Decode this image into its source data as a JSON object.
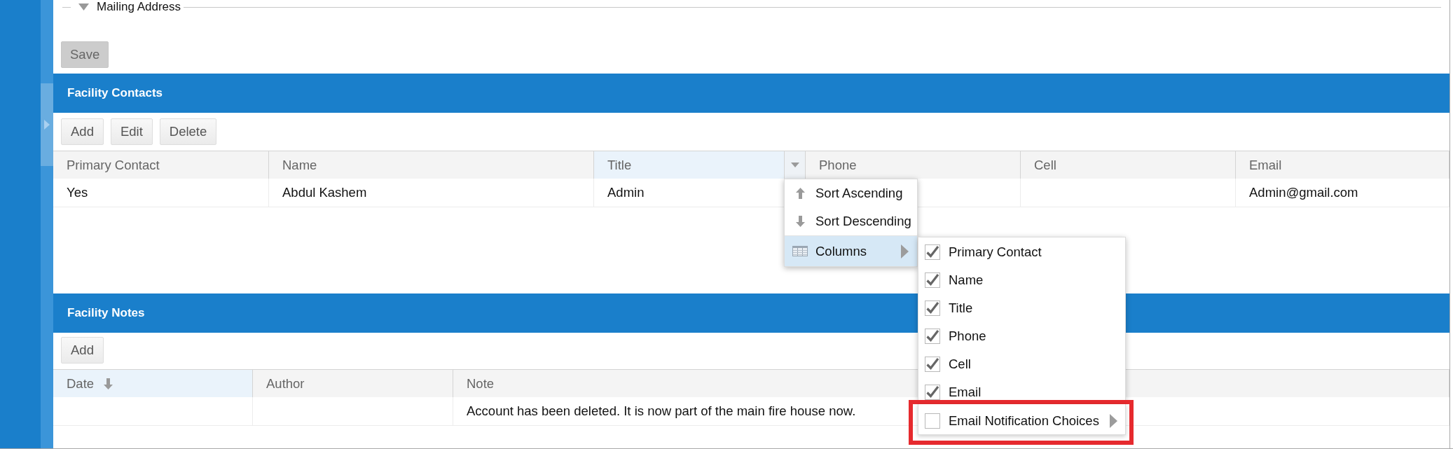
{
  "mailing_address": {
    "legend": "Mailing Address",
    "expanded": true
  },
  "save_button": {
    "label": "Save",
    "disabled": true
  },
  "contacts": {
    "title": "Facility Contacts",
    "toolbar": [
      {
        "label": "Add"
      },
      {
        "label": "Edit"
      },
      {
        "label": "Delete"
      }
    ],
    "columns": [
      {
        "label": "Primary Contact",
        "selected": false
      },
      {
        "label": "Name",
        "selected": false
      },
      {
        "label": "Title",
        "selected": true
      },
      {
        "label": "Phone",
        "selected": false
      },
      {
        "label": "Cell",
        "selected": false
      },
      {
        "label": "Email",
        "selected": false
      }
    ],
    "rows": [
      [
        "Yes",
        "Abdul Kashem",
        "Admin",
        null,
        null,
        "Admin@gmail.com"
      ]
    ]
  },
  "column_menu": {
    "items": [
      {
        "kind": "sort_asc",
        "label": "Sort Ascending",
        "selected": false
      },
      {
        "kind": "sort_desc",
        "label": "Sort Descending",
        "selected": false
      },
      {
        "kind": "separator"
      },
      {
        "kind": "columns",
        "label": "Columns",
        "selected": true,
        "submenu": {
          "items": [
            {
              "label": "Primary Contact",
              "checked": true,
              "has_submenu": false,
              "highlighted": false
            },
            {
              "label": "Name",
              "checked": true,
              "has_submenu": false,
              "highlighted": false
            },
            {
              "label": "Title",
              "checked": true,
              "has_submenu": false,
              "highlighted": false
            },
            {
              "label": "Phone",
              "checked": true,
              "has_submenu": false,
              "highlighted": false
            },
            {
              "label": "Cell",
              "checked": true,
              "has_submenu": false,
              "highlighted": false
            },
            {
              "label": "Email",
              "checked": true,
              "has_submenu": false,
              "highlighted": false
            },
            {
              "label": "Email Notification Choices",
              "checked": false,
              "has_submenu": true,
              "highlighted": true
            }
          ]
        }
      }
    ]
  },
  "notes": {
    "title": "Facility Notes",
    "toolbar": [
      {
        "label": "Add"
      }
    ],
    "columns": [
      {
        "label": "Date",
        "sorted_descending": true
      },
      {
        "label": "Author",
        "sorted_descending": false
      },
      {
        "label": "Note",
        "sorted_descending": false
      }
    ],
    "rows": [
      [
        null,
        null,
        "Account has been deleted. It is now part of the main fire house now."
      ]
    ]
  }
}
